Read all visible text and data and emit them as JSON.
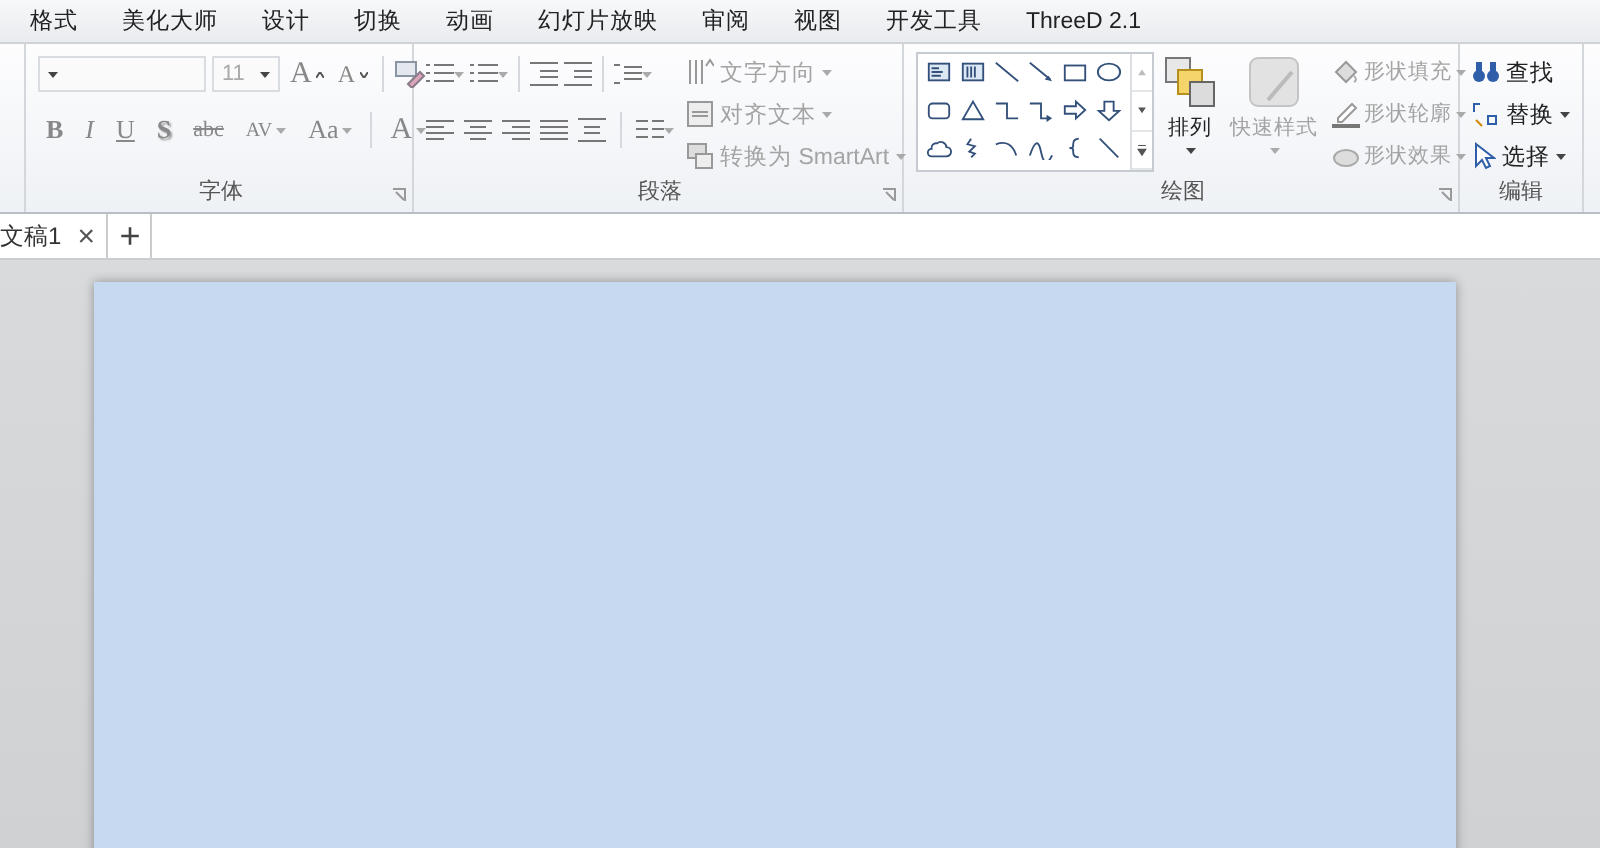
{
  "menu_tabs": [
    {
      "label": "格式"
    },
    {
      "label": "美化大师"
    },
    {
      "label": "设计"
    },
    {
      "label": "切换"
    },
    {
      "label": "动画"
    },
    {
      "label": "幻灯片放映"
    },
    {
      "label": "审阅"
    },
    {
      "label": "视图"
    },
    {
      "label": "开发工具"
    },
    {
      "label": "ThreeD 2.1"
    }
  ],
  "font_group": {
    "title": "字体",
    "disabled": true,
    "font_size": "11",
    "grow": "A",
    "shrink": "A",
    "color_label": "A",
    "formats": [
      {
        "kind": "bold",
        "label": "B"
      },
      {
        "kind": "italic",
        "label": "I"
      },
      {
        "kind": "underline",
        "label": "U"
      },
      {
        "kind": "shadow",
        "label": "S"
      },
      {
        "kind": "strike",
        "label": "abc"
      },
      {
        "kind": "spacing",
        "label": "AV"
      },
      {
        "kind": "case",
        "label": "Aa"
      }
    ]
  },
  "paragraph_group": {
    "title": "段落",
    "commands": [
      {
        "label": "文字方向",
        "disabled": true
      },
      {
        "label": "对齐文本",
        "disabled": true
      },
      {
        "label": "转换为 SmartArt",
        "disabled": true
      }
    ]
  },
  "drawing_group": {
    "title": "绘图",
    "arrange": {
      "label": "排列",
      "disabled": false
    },
    "quick_styles": {
      "label": "快速样式",
      "disabled": true
    },
    "commands": [
      {
        "label": "形状填充",
        "disabled": true
      },
      {
        "label": "形状轮廓",
        "disabled": true
      },
      {
        "label": "形状效果",
        "disabled": true
      }
    ]
  },
  "editing_group": {
    "title": "编辑",
    "commands": [
      {
        "label": "查找",
        "dropdown": false
      },
      {
        "label": "替换",
        "dropdown": true
      },
      {
        "label": "选择",
        "dropdown": true
      }
    ]
  },
  "document_tabs": [
    {
      "label": "文稿1",
      "selected": true,
      "close": "×"
    }
  ],
  "new_tab": "+"
}
